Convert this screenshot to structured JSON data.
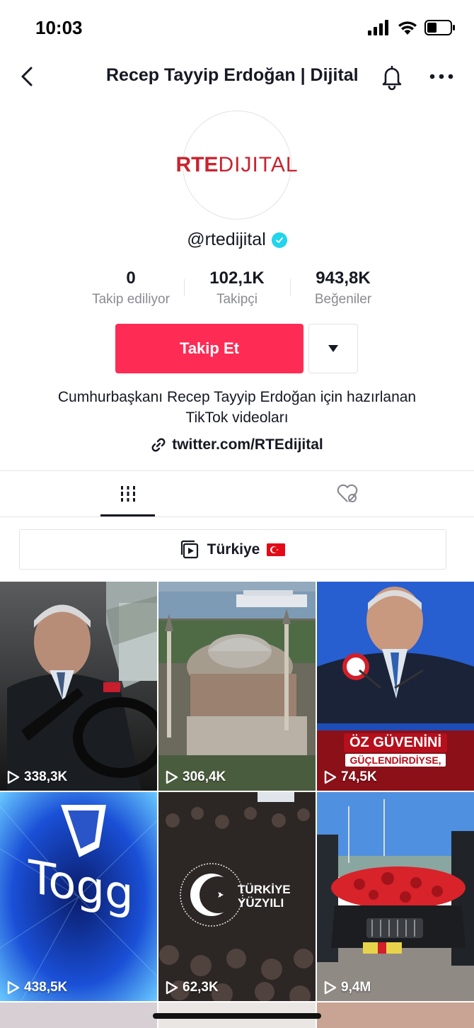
{
  "status_bar": {
    "time": "10:03"
  },
  "header": {
    "title": "Recep Tayyip Erdoğan | Dijital"
  },
  "profile": {
    "logo_text_bold": "RTE",
    "logo_text_light": "DIJITAL",
    "handle": "@rtedijital",
    "verified": true,
    "stats": [
      {
        "value": "0",
        "label": "Takip ediliyor"
      },
      {
        "value": "102,1K",
        "label": "Takipçi"
      },
      {
        "value": "943,8K",
        "label": "Beğeniler"
      }
    ],
    "follow_label": "Takip Et",
    "bio_line1": "Cumhurbaşkanı Recep Tayyip Erdoğan için hazırlanan",
    "bio_line2": "TikTok videoları",
    "link": "twitter.com/RTEdijital"
  },
  "tabs": [
    {
      "name": "videos",
      "icon": "grid-icon",
      "active": true
    },
    {
      "name": "liked",
      "icon": "liked-hidden-icon",
      "active": false
    }
  ],
  "playlist": {
    "label": "Türkiye"
  },
  "videos": [
    {
      "views": "338,3K",
      "overlay": ""
    },
    {
      "views": "306,4K",
      "overlay": ""
    },
    {
      "views": "74,5K",
      "overlay_line1": "ÖZ GÜVENİNİ",
      "overlay_line2": "GÜÇLENDİRDİYSE,"
    },
    {
      "views": "438,5K",
      "overlay": "Togg"
    },
    {
      "views": "62,3K",
      "overlay_line1": "TÜRKİYE",
      "overlay_line2": "YÜZYILI"
    },
    {
      "views": "9,4M",
      "overlay": ""
    }
  ],
  "colors": {
    "accent": "#fe2c55",
    "verified": "#20d5ec",
    "logo_red": "#c8242f"
  }
}
